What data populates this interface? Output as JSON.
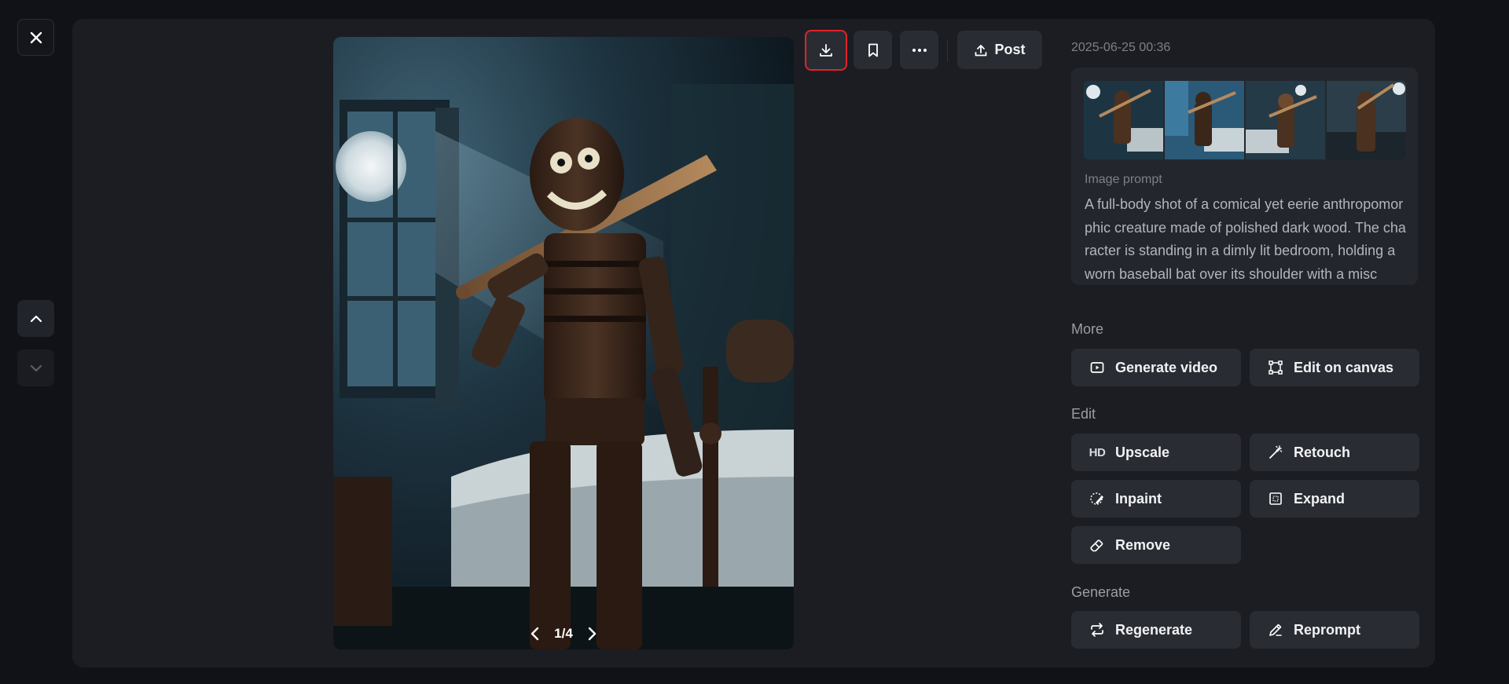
{
  "header": {
    "timestamp": "2025-06-25 00:36",
    "post_label": "Post"
  },
  "viewer": {
    "pager": "1/4"
  },
  "prompt": {
    "label": "Image prompt",
    "text": "A full-body shot of a comical yet eerie anthropomorphic creature made of polished dark wood. The character is standing in a dimly lit bedroom, holding a worn baseball bat over its shoulder with a misc"
  },
  "sections": {
    "more": {
      "title": "More",
      "items": [
        "Generate video",
        "Edit on canvas"
      ]
    },
    "edit": {
      "title": "Edit",
      "items": [
        "Upscale",
        "Retouch",
        "Inpaint",
        "Expand",
        "Remove"
      ],
      "hd_badge": "HD"
    },
    "generate": {
      "title": "Generate",
      "items": [
        "Regenerate",
        "Reprompt"
      ]
    }
  },
  "icons": {
    "close": "close-icon",
    "up": "chevron-up-icon",
    "down": "chevron-down-icon",
    "download": "download-icon",
    "bookmark": "bookmark-icon",
    "more": "more-horizontal-icon",
    "post": "upload-icon"
  },
  "colors": {
    "background": "#111217",
    "panel": "#1c1d23",
    "button": "#2a2c33",
    "highlight": "#e0232b"
  }
}
